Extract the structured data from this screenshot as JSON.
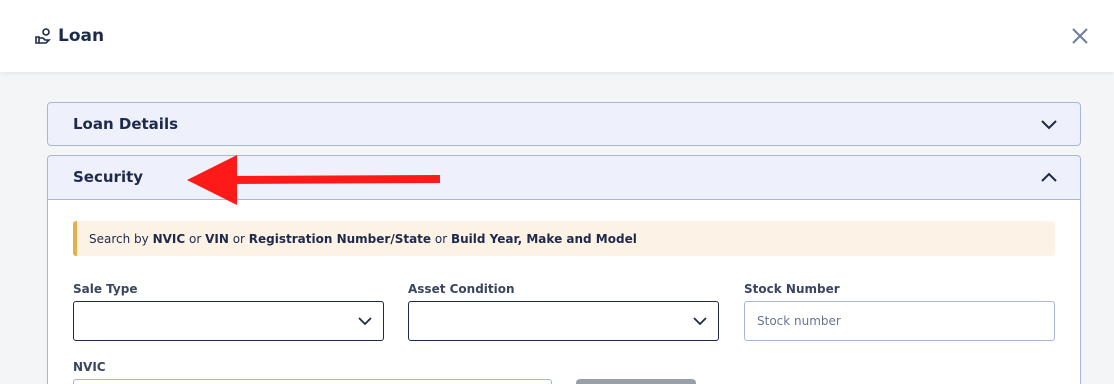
{
  "header": {
    "title": "Loan",
    "title_icon": "hand-coin-icon",
    "close_icon": "close-icon"
  },
  "panels": {
    "details": {
      "label": "Loan Details",
      "state": "collapsed"
    },
    "security": {
      "label": "Security",
      "state": "expanded"
    }
  },
  "notice": {
    "parts": [
      {
        "text": "Search by ",
        "bold": false
      },
      {
        "text": "NVIC",
        "bold": true
      },
      {
        "text": " or ",
        "bold": false
      },
      {
        "text": "VIN",
        "bold": true
      },
      {
        "text": " or ",
        "bold": false
      },
      {
        "text": "Registration Number/State",
        "bold": true
      },
      {
        "text": " or ",
        "bold": false
      },
      {
        "text": "Build Year, Make and Model",
        "bold": true
      }
    ]
  },
  "fields": {
    "sale_type": {
      "label": "Sale Type",
      "value": ""
    },
    "asset_condition": {
      "label": "Asset Condition",
      "value": ""
    },
    "stock_number": {
      "label": "Stock Number",
      "placeholder": "Stock number"
    },
    "nvic": {
      "label": "NVIC"
    }
  },
  "colors": {
    "annotation_arrow": "#ff1a1a",
    "notice_accent": "#e5b04a",
    "panel_bg": "#eef1fb"
  }
}
